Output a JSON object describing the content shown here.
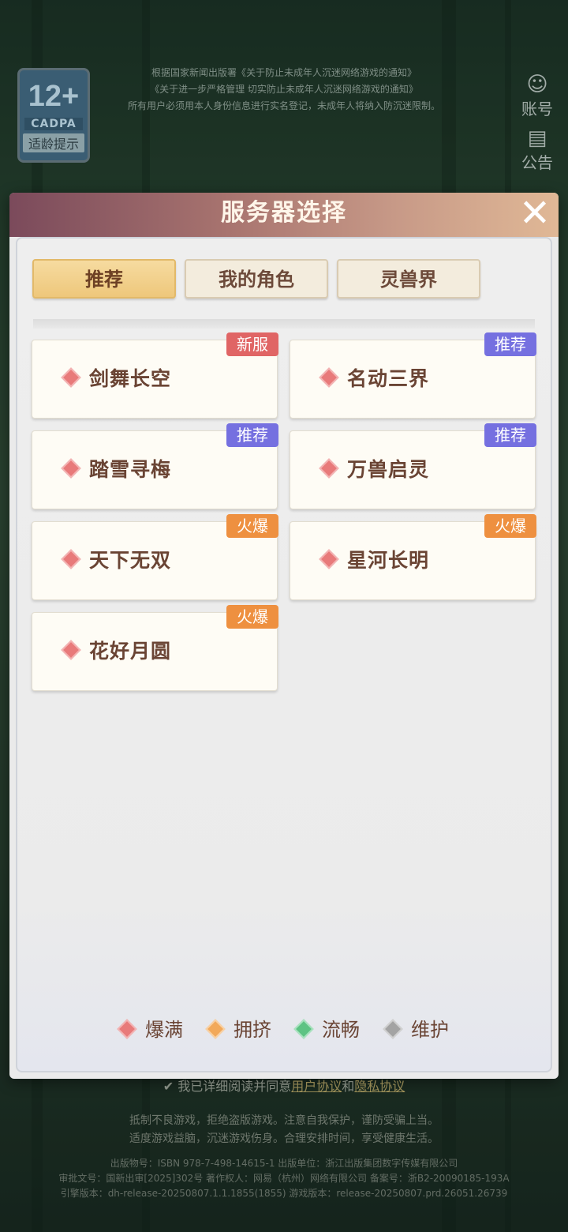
{
  "age_rating": {
    "number": "12+",
    "org": "CADPA",
    "tip": "适龄提示"
  },
  "top_notice": [
    "根据国家新闻出版署《关于防止未成年人沉迷网络游戏的通知》",
    "《关于进一步严格管理 切实防止未成年人沉迷网络游戏的通知》",
    "所有用户必须用本人身份信息进行实名登记，未成年人将纳入防沉迷限制。"
  ],
  "side_buttons": {
    "account": "账号",
    "notice": "公告"
  },
  "modal": {
    "title": "服务器选择",
    "tabs": [
      {
        "label": "推荐",
        "active": true
      },
      {
        "label": "我的角色",
        "active": false
      },
      {
        "label": "灵兽界",
        "active": false
      }
    ],
    "servers": [
      {
        "name": "剑舞长空",
        "tag": "新服",
        "tag_type": "new"
      },
      {
        "name": "名动三界",
        "tag": "推荐",
        "tag_type": "rec"
      },
      {
        "name": "踏雪寻梅",
        "tag": "推荐",
        "tag_type": "rec"
      },
      {
        "name": "万兽启灵",
        "tag": "推荐",
        "tag_type": "rec"
      },
      {
        "name": "天下无双",
        "tag": "火爆",
        "tag_type": "hot"
      },
      {
        "name": "星河长明",
        "tag": "火爆",
        "tag_type": "hot"
      },
      {
        "name": "花好月圆",
        "tag": "火爆",
        "tag_type": "hot"
      }
    ],
    "legend": [
      {
        "label": "爆满",
        "color": "#e87a7a"
      },
      {
        "label": "拥挤",
        "color": "#f2a95a"
      },
      {
        "label": "流畅",
        "color": "#5dc383"
      },
      {
        "label": "维护",
        "color": "#a3a3a3"
      }
    ]
  },
  "agreement": {
    "prefix": "我已详细阅读并同意",
    "user_agreement": "用户协议",
    "and": "和",
    "privacy": "隐私协议"
  },
  "health_notice": [
    "抵制不良游戏，拒绝盗版游戏。注意自我保护，谨防受骗上当。",
    "适度游戏益脑，沉迷游戏伤身。合理安排时间，享受健康生活。"
  ],
  "footer": {
    "line1": "出版物号：ISBN 978-7-498-14615-1      出版单位：浙江出版集团数字传媒有限公司",
    "line2": "审批文号：国新出审[2025]302号      著作权人：网易（杭州）网络有限公司      备案号：浙B2-20090185-193A",
    "line3": "引擎版本：dh-release-20250807.1.1.1855(1855)      游戏版本：release-20250807.prd.26051.26739"
  }
}
